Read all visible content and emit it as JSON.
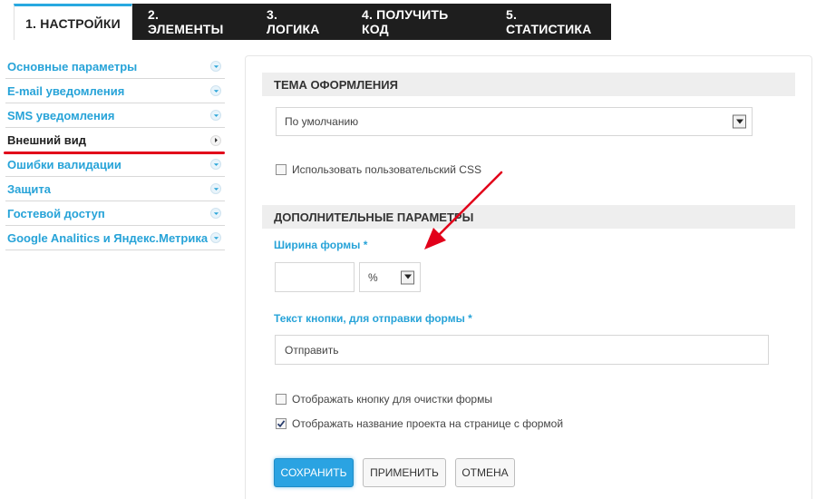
{
  "tabs": [
    {
      "label": "1. НАСТРОЙКИ",
      "active": true
    },
    {
      "label": "2. ЭЛЕМЕНТЫ"
    },
    {
      "label": "3. ЛОГИКА"
    },
    {
      "label": "4. ПОЛУЧИТЬ КОД"
    },
    {
      "label": "5. СТАТИСТИКА"
    }
  ],
  "menu": {
    "items": [
      {
        "label": "Основные параметры"
      },
      {
        "label": "E-mail уведомления"
      },
      {
        "label": "SMS уведомления"
      },
      {
        "label": "Внешний вид",
        "active": true
      },
      {
        "label": "Ошибки валидации"
      },
      {
        "label": "Защита"
      },
      {
        "label": "Гостевой доступ"
      },
      {
        "label": "Google Analitics и Яндекс.Метрика"
      }
    ]
  },
  "theme": {
    "header": "ТЕМА ОФОРМЛЕНИЯ",
    "select_value": "По умолчанию",
    "custom_css_label": "Использовать пользовательский CSS",
    "custom_css_checked": false
  },
  "extra": {
    "header": "ДОПОЛНИТЕЛЬНЫЕ ПАРАМЕТРЫ",
    "width_label": "Ширина формы *",
    "width_value": "",
    "width_unit": "%",
    "button_text_label": "Текст кнопки, для отправки формы *",
    "button_text_value": "Отправить",
    "show_clear_label": "Отображать кнопку для очистки формы",
    "show_clear_checked": false,
    "show_project_label": "Отображать название проекта на странице с формой",
    "show_project_checked": true
  },
  "actions": {
    "save": "СОХРАНИТЬ",
    "apply": "ПРИМЕНИТЬ",
    "cancel": "ОТМЕНА"
  },
  "colors": {
    "accent": "#27a3d8",
    "tab_dark": "#1e1e1e",
    "highlight_underline": "#e2001a",
    "annotation_arrow": "#e2001a"
  }
}
